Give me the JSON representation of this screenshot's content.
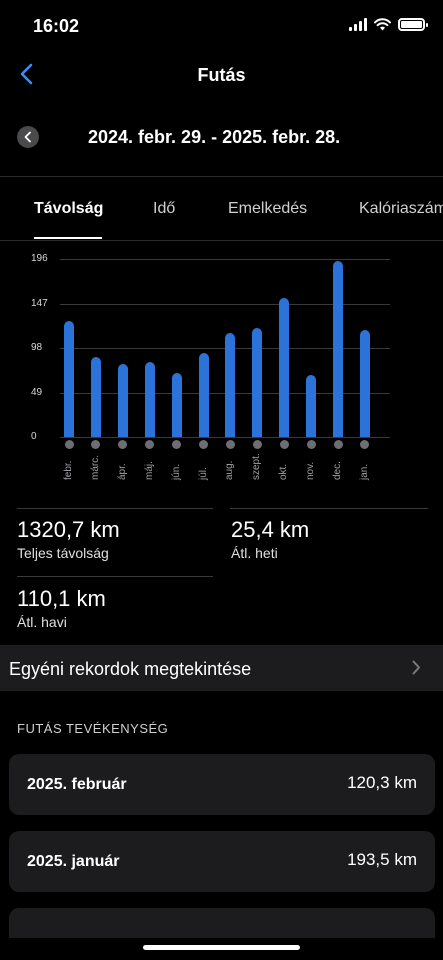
{
  "status": {
    "time": "16:02"
  },
  "nav": {
    "title": "Futás",
    "back_icon": "chevron-left-icon"
  },
  "date_range": {
    "label": "2024. febr. 29. - 2025. febr. 28.",
    "prev_icon": "chevron-left-icon"
  },
  "tabs": [
    {
      "label": "Távolság",
      "active": true
    },
    {
      "label": "Idő",
      "active": false
    },
    {
      "label": "Emelkedés",
      "active": false
    },
    {
      "label": "Kalóriaszám",
      "active": false
    }
  ],
  "chart_data": {
    "type": "bar",
    "categories": [
      "febr.",
      "márc.",
      "ápr.",
      "máj.",
      "jún.",
      "júl.",
      "aug.",
      "szept.",
      "okt.",
      "nov.",
      "dec.",
      "jan."
    ],
    "values": [
      128,
      88,
      80,
      83,
      70,
      92,
      115,
      120,
      153,
      68,
      193.5,
      118
    ],
    "yticks": [
      196,
      147,
      98,
      49,
      0
    ],
    "ylim": [
      0,
      196
    ],
    "grid": true,
    "bar_color": "#2b73d8"
  },
  "stats": {
    "total": {
      "value": "1320,7 km",
      "label": "Teljes távolság"
    },
    "weekly": {
      "value": "25,4 km",
      "label": "Átl. heti"
    },
    "monthly": {
      "value": "110,1 km",
      "label": "Átl. havi"
    }
  },
  "records": {
    "label": "Egyéni rekordok megtekintése",
    "icon": "chevron-right-icon"
  },
  "activity": {
    "header": "FUTÁS TEVÉKENYSÉG",
    "items": [
      {
        "title": "2025. február",
        "value": "120,3 km"
      },
      {
        "title": "2025. január",
        "value": "193,5 km"
      }
    ]
  }
}
